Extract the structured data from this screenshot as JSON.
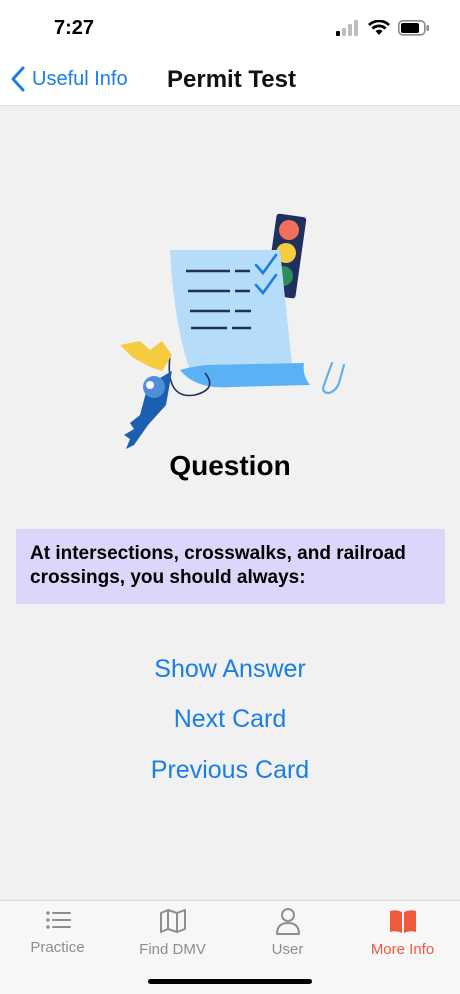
{
  "status_bar": {
    "time": "7:27"
  },
  "nav": {
    "back_label": "Useful Info",
    "title": "Permit Test"
  },
  "card": {
    "heading": "Question",
    "question": "At intersections, crosswalks, and railroad crossings, you should always:"
  },
  "actions": {
    "show_answer": "Show Answer",
    "next_card": "Next Card",
    "previous_card": "Previous Card"
  },
  "tabs": [
    {
      "label": "Practice",
      "icon": "list-icon",
      "active": false
    },
    {
      "label": "Find DMV",
      "icon": "map-icon",
      "active": false
    },
    {
      "label": "User",
      "icon": "user-icon",
      "active": false
    },
    {
      "label": "More Info",
      "icon": "book-icon",
      "active": true
    }
  ],
  "colors": {
    "accent": "#1a7ee3",
    "active_tab": "#f05a3c",
    "question_bg": "#dcd6fb",
    "background": "#f1f1f1"
  }
}
